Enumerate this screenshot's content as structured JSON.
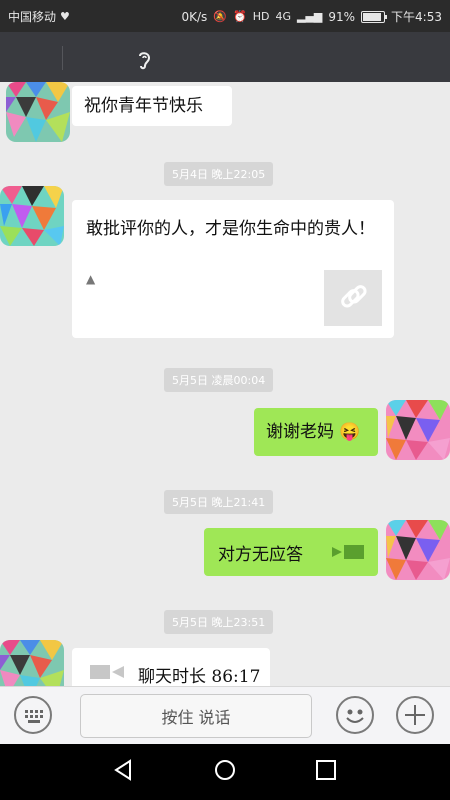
{
  "status_bar": {
    "carrier": "中国移动",
    "speed": "0K/s",
    "network": "4G",
    "battery_text": "91%",
    "battery_level": 0.91,
    "time": "下午4:53"
  },
  "messages": [
    {
      "side": "left",
      "text": "祝你青年节快乐"
    },
    {
      "timestamp": "5月4日 晚上22:05"
    },
    {
      "side": "left",
      "type": "link",
      "text": "敢批评你的人，才是你生命中的贵人！"
    },
    {
      "timestamp": "5月5日 凌晨00:04"
    },
    {
      "side": "right",
      "text": "谢谢老妈",
      "emoji": "😝"
    },
    {
      "timestamp": "5月5日 晚上21:41"
    },
    {
      "side": "right",
      "type": "video-call",
      "text": "对方无应答"
    },
    {
      "timestamp": "5月5日 晚上23:51"
    },
    {
      "side": "left",
      "type": "video-call",
      "text": "聊天时长 86:17"
    }
  ],
  "input": {
    "hold_to_talk": "按住 说话"
  },
  "colors": {
    "accent_green": "#9fe756",
    "header_bg": "#393a3f"
  }
}
